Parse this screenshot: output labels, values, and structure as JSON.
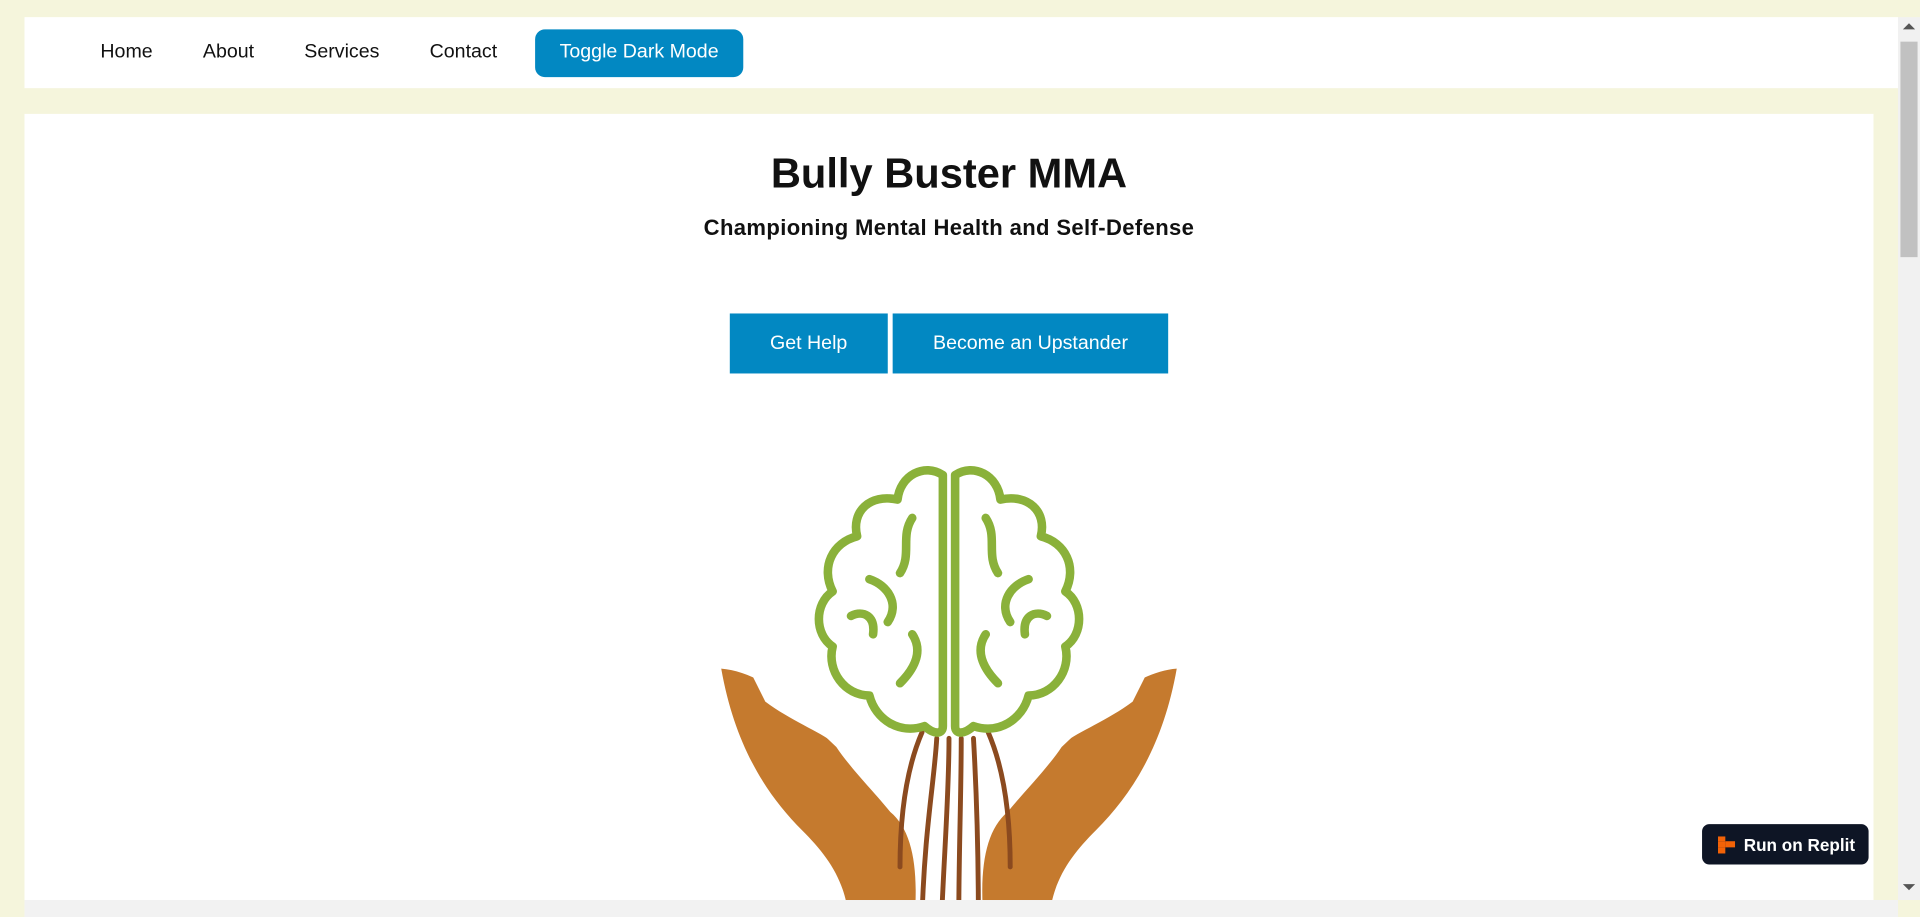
{
  "nav": {
    "links": [
      "Home",
      "About",
      "Services",
      "Contact"
    ],
    "toggle_label": "Toggle Dark Mode"
  },
  "hero": {
    "title": "Bully Buster MMA",
    "subtitle": "Championing Mental Health and Self-Defense",
    "buttons": [
      "Get Help",
      "Become an Upstander"
    ]
  },
  "logo": {
    "icon": "brain-in-hands-icon",
    "colors": {
      "brain": "#8ab13a",
      "hands": "#c57a2e",
      "roots": "#8b4a1f"
    }
  },
  "badge": {
    "label": "Run on Replit",
    "icon": "replit-icon",
    "icon_color": "#f26207"
  },
  "colors": {
    "page_bg": "#f5f5dc",
    "accent": "#0288c2",
    "badge_bg": "#0e1525"
  }
}
